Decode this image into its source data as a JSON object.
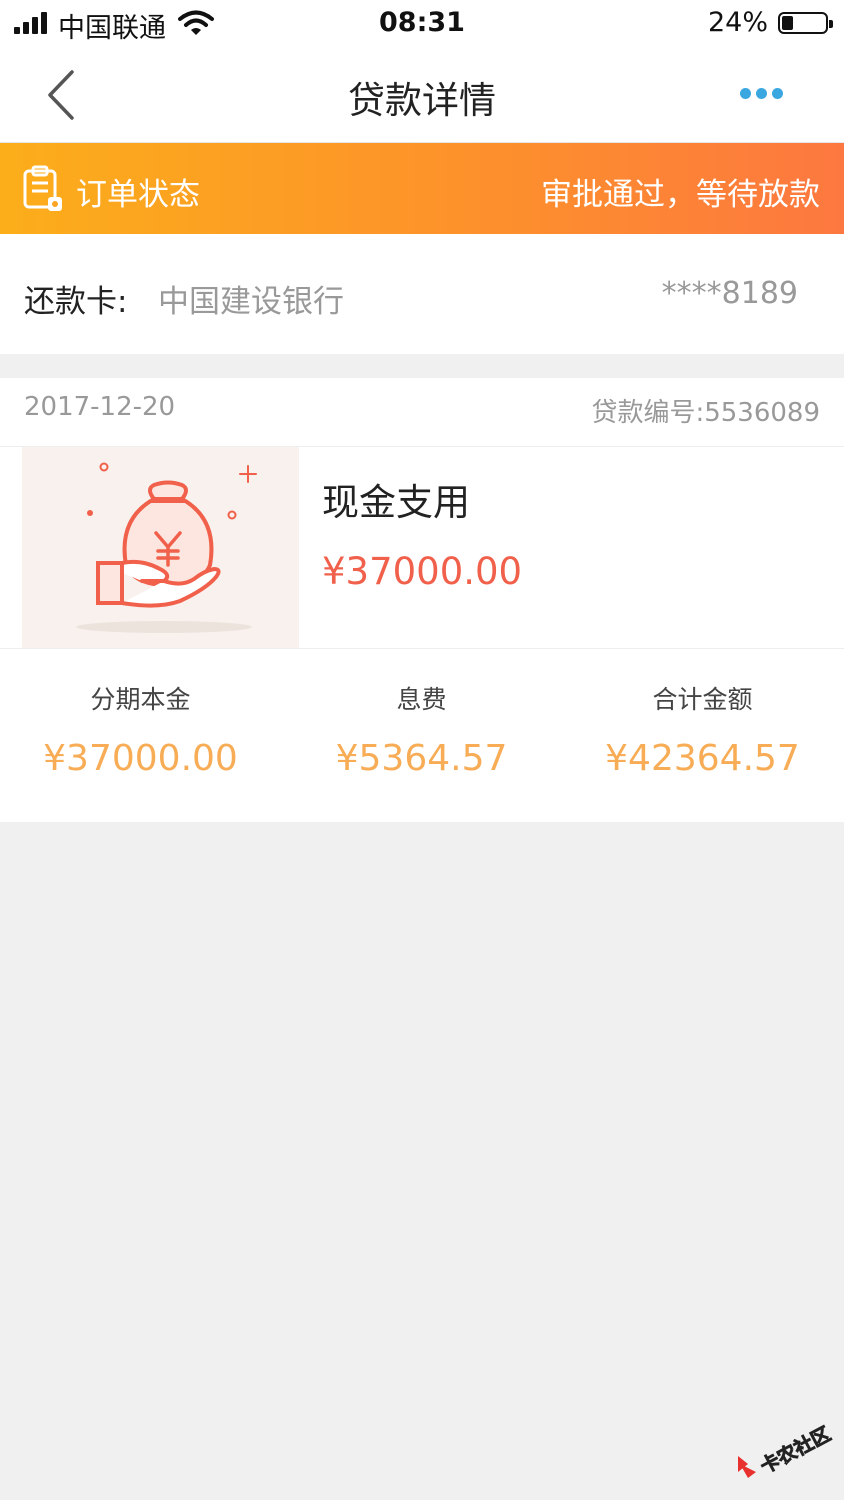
{
  "status_bar": {
    "carrier": "中国联通",
    "time": "08:31",
    "battery": "24%"
  },
  "nav": {
    "title": "贷款详情",
    "back_icon": "chevron-left-icon",
    "more_icon": "more-dots-icon",
    "accent_color": "#3aa7e0"
  },
  "order_status": {
    "label": "订单状态",
    "value": "审批通过，等待放款",
    "icon": "clipboard-icon",
    "gradient": [
      "#fcae1a",
      "#fd7840"
    ]
  },
  "repay_card": {
    "label": "还款卡:",
    "bank": "中国建设银行",
    "card_number": "****8189"
  },
  "order": {
    "date": "2017-12-20",
    "loan_number": "贷款编号:5536089",
    "product_icon": "money-bag-hand-icon",
    "product_name": "现金支用",
    "amount": "¥37000.00",
    "stats": [
      {
        "label": "分期本金",
        "value": "¥37000.00"
      },
      {
        "label": "息费",
        "value": "¥5364.57"
      },
      {
        "label": "合计金额",
        "value": "¥42364.57"
      }
    ]
  },
  "watermark": {
    "text": "卡农社区"
  }
}
